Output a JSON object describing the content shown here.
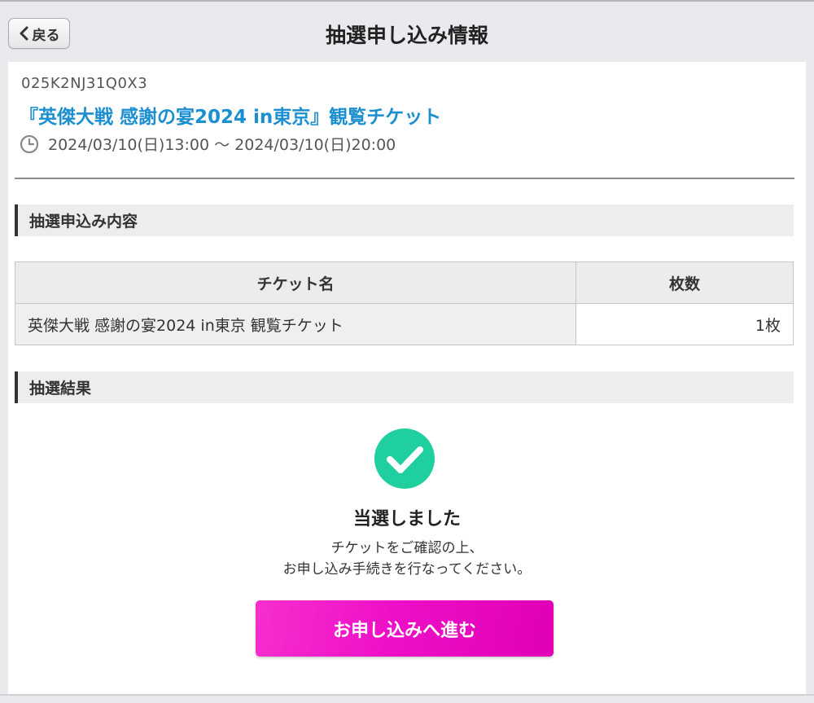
{
  "nav": {
    "back_label": "戻る",
    "title": "抽選申し込み情報"
  },
  "event": {
    "code": "025K2NJ31Q0X3",
    "title": "『英傑大戦 感謝の宴2024 in東京』観覧チケット",
    "date_range": "2024/03/10(日)13:00 〜 2024/03/10(日)20:00"
  },
  "application": {
    "section_title": "抽選申込み内容",
    "table": {
      "headers": [
        "チケット名",
        "枚数"
      ],
      "rows": [
        {
          "name": "英傑大戦 感謝の宴2024 in東京 観覧チケット",
          "qty": "1枚"
        }
      ]
    }
  },
  "result": {
    "section_title": "抽選結果",
    "status": "当選しました",
    "message_line1": "チケットをご確認の上、",
    "message_line2": "お申し込み手続きを行なってください。",
    "proceed_label": "お申し込みへ進む"
  },
  "colors": {
    "accent_blue": "#1c8fd1",
    "success_green": "#1fcf9f",
    "button_magenta": "#ee10c8"
  },
  "icons": [
    "chevron-left-icon",
    "clock-icon",
    "check-circle-icon"
  ]
}
